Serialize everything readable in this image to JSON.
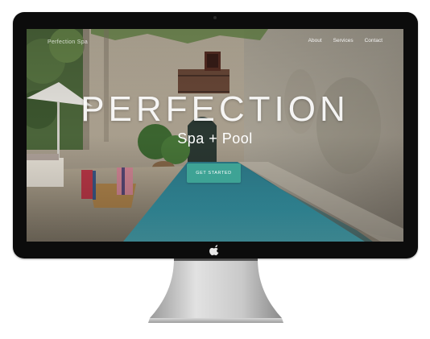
{
  "site": {
    "brand": "Perfection Spa",
    "nav": [
      {
        "label": "About"
      },
      {
        "label": "Services"
      },
      {
        "label": "Contact"
      }
    ],
    "hero_title": "PERFECTION",
    "hero_subtitle": "Spa + Pool",
    "cta_label": "GET STARTED"
  },
  "colors": {
    "accent": "#3ea395",
    "bezel": "#0c0c0c",
    "pool": "#3a8fa0"
  },
  "icons": {
    "device_logo": "apple-logo-icon"
  }
}
